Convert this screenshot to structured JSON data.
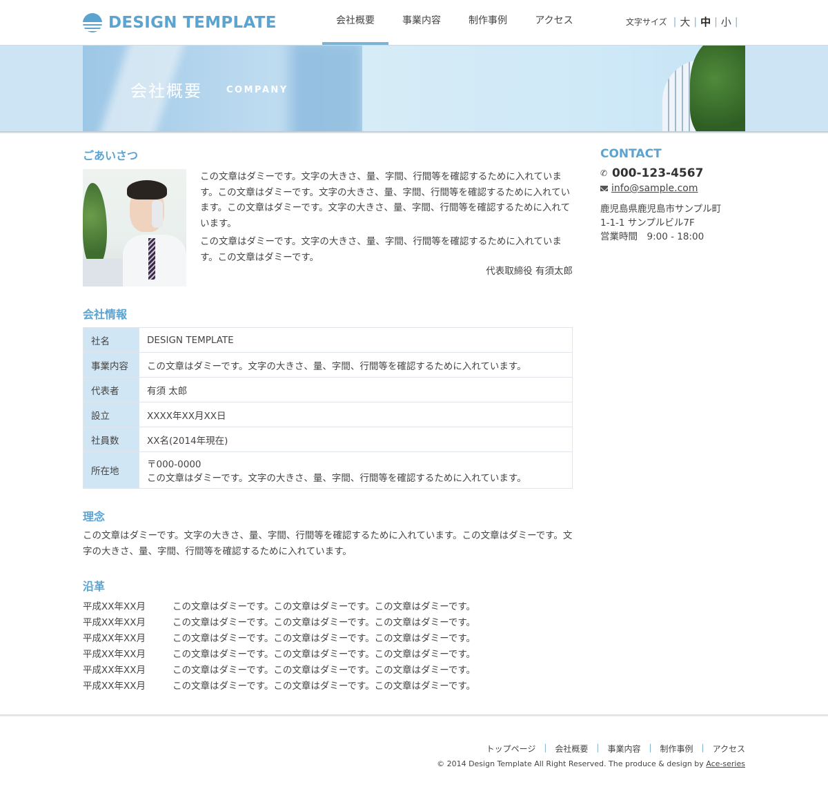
{
  "header": {
    "logo_text": "DESIGN TEMPLATE",
    "nav": [
      {
        "label": "会社概要",
        "active": true
      },
      {
        "label": "事業内容"
      },
      {
        "label": "制作事例"
      },
      {
        "label": "アクセス"
      }
    ],
    "font_size": {
      "label": "文字サイズ",
      "large": "大",
      "medium": "中",
      "small": "小"
    }
  },
  "banner": {
    "title": "会社概要",
    "subtitle": "COMPANY"
  },
  "greeting": {
    "heading": "ごあいさつ",
    "paragraphs": [
      "この文章はダミーです。文字の大きさ、量、字間、行間等を確認するために入れています。この文章はダミーです。文字の大きさ、量、字間、行間等を確認するために入れています。この文章はダミーです。文字の大きさ、量、字間、行間等を確認するために入れています。",
      "この文章はダミーです。文字の大きさ、量、字間、行間等を確認するために入れています。この文章はダミーです。"
    ],
    "signature": "代表取締役 有須太郎"
  },
  "company_info": {
    "heading": "会社情報",
    "rows": [
      {
        "label": "社名",
        "value": "DESIGN TEMPLATE"
      },
      {
        "label": "事業内容",
        "value": "この文章はダミーです。文字の大きさ、量、字間、行間等を確認するために入れています。"
      },
      {
        "label": "代表者",
        "value": "有須 太郎"
      },
      {
        "label": "設立",
        "value": "XXXX年XX月XX日"
      },
      {
        "label": "社員数",
        "value": "XX名(2014年現在)"
      },
      {
        "label": "所在地",
        "value": "〒000-0000",
        "value2": "この文章はダミーです。文字の大きさ、量、字間、行間等を確認するために入れています。"
      }
    ]
  },
  "philosophy": {
    "heading": "理念",
    "text": "この文章はダミーです。文字の大きさ、量、字間、行間等を確認するために入れています。この文章はダミーです。文字の大きさ、量、字間、行間等を確認するために入れています。"
  },
  "history": {
    "heading": "沿革",
    "rows": [
      {
        "date": "平成XX年XX月",
        "text": "この文章はダミーです。この文章はダミーです。この文章はダミーです。"
      },
      {
        "date": "平成XX年XX月",
        "text": "この文章はダミーです。この文章はダミーです。この文章はダミーです。"
      },
      {
        "date": "平成XX年XX月",
        "text": "この文章はダミーです。この文章はダミーです。この文章はダミーです。"
      },
      {
        "date": "平成XX年XX月",
        "text": "この文章はダミーです。この文章はダミーです。この文章はダミーです。"
      },
      {
        "date": "平成XX年XX月",
        "text": "この文章はダミーです。この文章はダミーです。この文章はダミーです。"
      },
      {
        "date": "平成XX年XX月",
        "text": "この文章はダミーです。この文章はダミーです。この文章はダミーです。"
      }
    ]
  },
  "sidebar": {
    "title": "CONTACT",
    "phone": "000-123-4567",
    "email": "info@sample.com",
    "address_lines": [
      "鹿児島県鹿児島市サンプル町",
      "1-1-1 サンプルビル7F",
      "営業時間　9:00 - 18:00"
    ]
  },
  "footer": {
    "nav": [
      "トップページ",
      "会社概要",
      "事業内容",
      "制作事例",
      "アクセス"
    ],
    "copyright_prefix": "© 2014 Design Template All Right Reserved. The produce & design by ",
    "copyright_link": "Ace-series"
  },
  "colors": {
    "accent": "#5ba3d0",
    "table_header_bg": "#d1e6f5"
  }
}
